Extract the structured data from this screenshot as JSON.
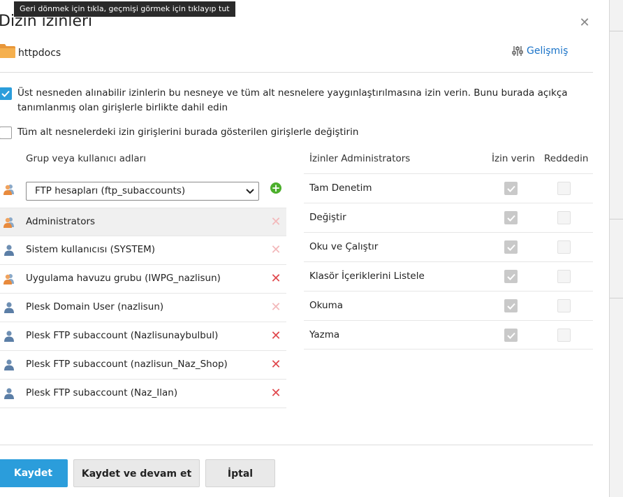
{
  "tooltip": "Geri dönmek için tıkla, geçmişi görmek için tıklayıp tut",
  "dialog": {
    "title": "Dizin izinleri",
    "close_icon": "close-icon",
    "folder_name": "httpdocs",
    "advanced_label": "Gelişmiş"
  },
  "options": {
    "inherit_label": "Üst nesneden alınabilir izinlerin bu nesneye ve tüm alt nesnelere yaygınlaştırılmasına izin verin. Bunu burada açıkça tanımlanmış olan girişlerle birlikte dahil edin",
    "inherit_checked": true,
    "replace_label": "Tüm alt nesnelerdeki izin girişlerini burada gösterilen girişlerle değiştirin",
    "replace_checked": false
  },
  "users": {
    "header": "Grup veya kullanıcı adları",
    "select_value": "FTP hesapları (ftp_subaccounts)",
    "items": [
      {
        "label": "Administrators",
        "icon": "group-icon",
        "removable": false,
        "selected": true
      },
      {
        "label": "Sistem kullanıcısı (SYSTEM)",
        "icon": "user-icon",
        "removable": false,
        "selected": false
      },
      {
        "label": "Uygulama havuzu grubu (IWPG_nazlisun)",
        "icon": "group-icon",
        "removable": true,
        "selected": false
      },
      {
        "label": "Plesk Domain User (nazlisun)",
        "icon": "user-icon",
        "removable": false,
        "selected": false
      },
      {
        "label": "Plesk FTP subaccount (Nazlisunaybulbul)",
        "icon": "user-icon",
        "removable": true,
        "selected": false
      },
      {
        "label": "Plesk FTP subaccount (nazlisun_Naz_Shop)",
        "icon": "user-icon",
        "removable": true,
        "selected": false
      },
      {
        "label": "Plesk FTP subaccount (Naz_Ilan)",
        "icon": "user-icon",
        "removable": true,
        "selected": false
      }
    ]
  },
  "permissions": {
    "header": "İzinler Administrators",
    "allow_header": "İzin verin",
    "deny_header": "Reddedin",
    "rows": [
      {
        "label": "Tam Denetim",
        "allow": true,
        "deny": false
      },
      {
        "label": "Değiştir",
        "allow": true,
        "deny": false
      },
      {
        "label": "Oku ve Çalıştır",
        "allow": true,
        "deny": false
      },
      {
        "label": "Klasör İçeriklerini Listele",
        "allow": true,
        "deny": false
      },
      {
        "label": "Okuma",
        "allow": true,
        "deny": false
      },
      {
        "label": "Yazma",
        "allow": true,
        "deny": false
      }
    ]
  },
  "footer": {
    "save": "Kaydet",
    "save_continue": "Kaydet ve devam et",
    "cancel": "İptal"
  },
  "colors": {
    "accent": "#2b9ddb",
    "link": "#1a73c8",
    "delete_active": "#e0474c",
    "delete_disabled": "#f3b8ba",
    "add": "#4caf2c"
  }
}
